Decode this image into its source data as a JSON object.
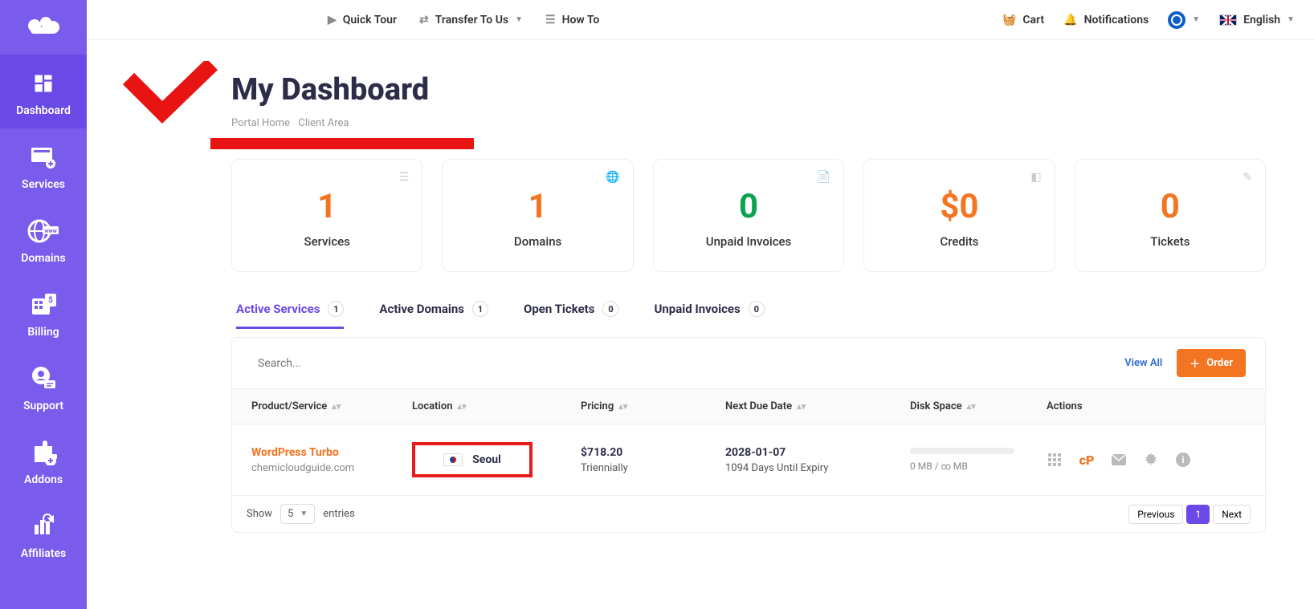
{
  "topbar": {
    "quick_tour": "Quick Tour",
    "transfer": "Transfer To Us",
    "how_to": "How To",
    "cart": "Cart",
    "notifications": "Notifications",
    "language": "English"
  },
  "sidebar": {
    "items": [
      {
        "label": "Dashboard"
      },
      {
        "label": "Services"
      },
      {
        "label": "Domains"
      },
      {
        "label": "Billing"
      },
      {
        "label": "Support"
      },
      {
        "label": "Addons"
      },
      {
        "label": "Affiliates"
      }
    ]
  },
  "page": {
    "title": "My Dashboard",
    "breadcrumb_home": "Portal Home",
    "breadcrumb_current": "Client Area"
  },
  "stats": [
    {
      "value": "1",
      "label": "Services",
      "color": "c-orange"
    },
    {
      "value": "1",
      "label": "Domains",
      "color": "c-orange"
    },
    {
      "value": "0",
      "label": "Unpaid Invoices",
      "color": "c-green"
    },
    {
      "value": "$0",
      "label": "Credits",
      "color": "c-orange"
    },
    {
      "value": "0",
      "label": "Tickets",
      "color": "c-orange"
    }
  ],
  "tabs": [
    {
      "label": "Active Services",
      "count": "1"
    },
    {
      "label": "Active Domains",
      "count": "1"
    },
    {
      "label": "Open Tickets",
      "count": "0"
    },
    {
      "label": "Unpaid Invoices",
      "count": "0"
    }
  ],
  "panel": {
    "search_placeholder": "Search...",
    "view_all": "View All",
    "order": "Order"
  },
  "columns": {
    "product": "Product/Service",
    "location": "Location",
    "pricing": "Pricing",
    "due": "Next Due Date",
    "disk": "Disk Space",
    "actions": "Actions"
  },
  "row": {
    "product": "WordPress Turbo",
    "domain": "chemicloudguide.com",
    "location": "Seoul",
    "price": "$718.20",
    "period": "Triennially",
    "due_date": "2028-01-07",
    "expiry": "1094 Days Until Expiry",
    "disk_text": "0 MB / ∞ MB"
  },
  "footer": {
    "show": "Show",
    "per_page": "5",
    "entries": "entries",
    "prev": "Previous",
    "page": "1",
    "next": "Next"
  }
}
